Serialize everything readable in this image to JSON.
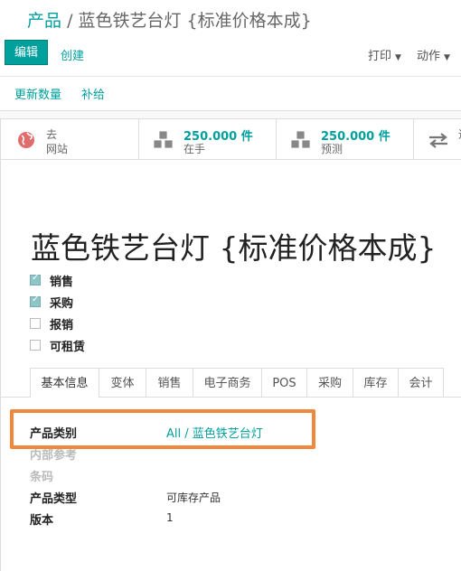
{
  "breadcrumb": {
    "parent": "产品",
    "separator": "/",
    "current": "蓝色铁艺台灯 {标准价格本成}"
  },
  "toolbar": {
    "edit_label": "编辑",
    "create_label": "创建",
    "print_label": "打印",
    "action_label": "动作"
  },
  "actions": {
    "update_qty": "更新数量",
    "replenish": "补给"
  },
  "smart_buttons": [
    {
      "icon": "globe-icon",
      "line1": "去",
      "line2": "网站"
    },
    {
      "icon": "cubes-icon",
      "value": "250.000 件",
      "label": "在手"
    },
    {
      "icon": "cubes-icon",
      "value": "250.000 件",
      "label": "预测"
    },
    {
      "icon": "exchange-icon",
      "label": "进"
    }
  ],
  "product": {
    "name": "蓝色铁艺台灯 {标准价格本成}"
  },
  "checkboxes": [
    {
      "label": "销售",
      "checked": true
    },
    {
      "label": "采购",
      "checked": true
    },
    {
      "label": "报销",
      "checked": false
    },
    {
      "label": "可租赁",
      "checked": false
    }
  ],
  "tabs": [
    "基本信息",
    "变体",
    "销售",
    "电子商务",
    "POS",
    "采购",
    "库存",
    "会计"
  ],
  "fields": {
    "category_label": "产品类别",
    "category_value": "All / 蓝色铁艺台灯",
    "internal_ref_label": "内部参考",
    "barcode_label": "条码",
    "type_label": "产品类型",
    "type_value": "可库存产品",
    "version_label": "版本",
    "version_value": "1"
  },
  "colors": {
    "accent": "#00a09d",
    "highlight": "#f0873a"
  }
}
